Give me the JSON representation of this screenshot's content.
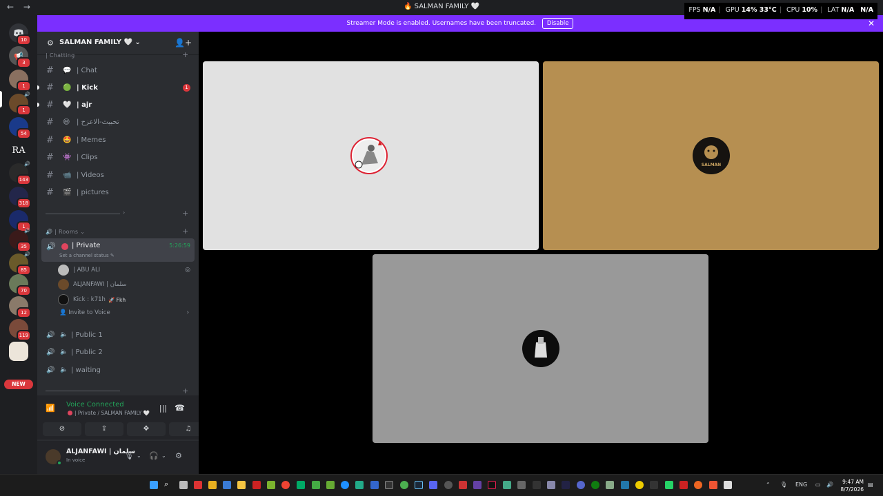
{
  "window": {
    "title": "🔥 SALMAN FAMILY 🤍",
    "nav_back": "←",
    "nav_forward": "→"
  },
  "perf": {
    "fps_label": "FPS",
    "fps": "N/A",
    "gpu_label": "GPU",
    "gpu": "14% 33°C",
    "cpu_label": "CPU",
    "cpu": "10%",
    "lat_label": "LAT",
    "lat": "N/A",
    "lat2": "N/A"
  },
  "banner": {
    "text": "Streamer Mode is enabled. Usernames have been truncated.",
    "button": "Disable",
    "close": "✕"
  },
  "server": {
    "name": "SALMAN FAMILY 🤍",
    "chevron": "⌄"
  },
  "rail": [
    {
      "badge": "10"
    },
    {
      "badge": "3"
    },
    {
      "badge": "1"
    },
    {
      "badge": "1"
    },
    {
      "badge": "54"
    },
    {
      "label": "RA"
    },
    {
      "badge": "143"
    },
    {
      "badge": "318"
    },
    {
      "badge": "1"
    },
    {
      "badge": "35"
    },
    {
      "badge": "85"
    },
    {
      "badge": "70"
    },
    {
      "badge": "12"
    },
    {
      "badge": "119"
    }
  ],
  "new_tag": "NEW",
  "categories": {
    "chatting": "| Chatting",
    "rooms": "| Rooms"
  },
  "text_channels": [
    {
      "emoji": "💬",
      "label": "| Chat"
    },
    {
      "emoji": "🟢",
      "label": "| Kick",
      "mention": "1"
    },
    {
      "emoji": "🤍",
      "label": "| ajr"
    },
    {
      "emoji": "😄",
      "label": "| تحبيث-الاعزح"
    },
    {
      "emoji": "🤩",
      "label": "| Memes"
    },
    {
      "emoji": "👾",
      "label": "| Clips"
    },
    {
      "emoji": "📹",
      "label": "| Videos"
    },
    {
      "emoji": "🎬",
      "label": "| pictures"
    }
  ],
  "active_voice": {
    "name": "| Private",
    "time": "5:26:59",
    "status": "Set a channel status ✎"
  },
  "members": [
    {
      "name": "| ABU ALI"
    },
    {
      "name": "ALJANFAWI | سلمان"
    },
    {
      "name": "Kick : k71h",
      "tag": "🚀 Fkh"
    }
  ],
  "invite_voice": "Invite to Voice",
  "voice_channels": [
    {
      "label": "| Public 1"
    },
    {
      "label": "| Public 2"
    },
    {
      "label": "| waiting"
    }
  ],
  "voice_panel": {
    "status": "Voice Connected",
    "channel": "| Private / SALMAN FAMILY 🤍"
  },
  "user": {
    "name": "ALJANFAWI | سلمان",
    "status": "In voice"
  },
  "tiles": [
    {
      "color": "#e1e1e1"
    },
    {
      "color": "#b68f51",
      "avatar_text": "SALMAN"
    },
    {
      "color": "#999999"
    }
  ],
  "taskbar": {
    "lang": "ENG",
    "time": "9:47 AM",
    "date": "8/7/2026"
  }
}
